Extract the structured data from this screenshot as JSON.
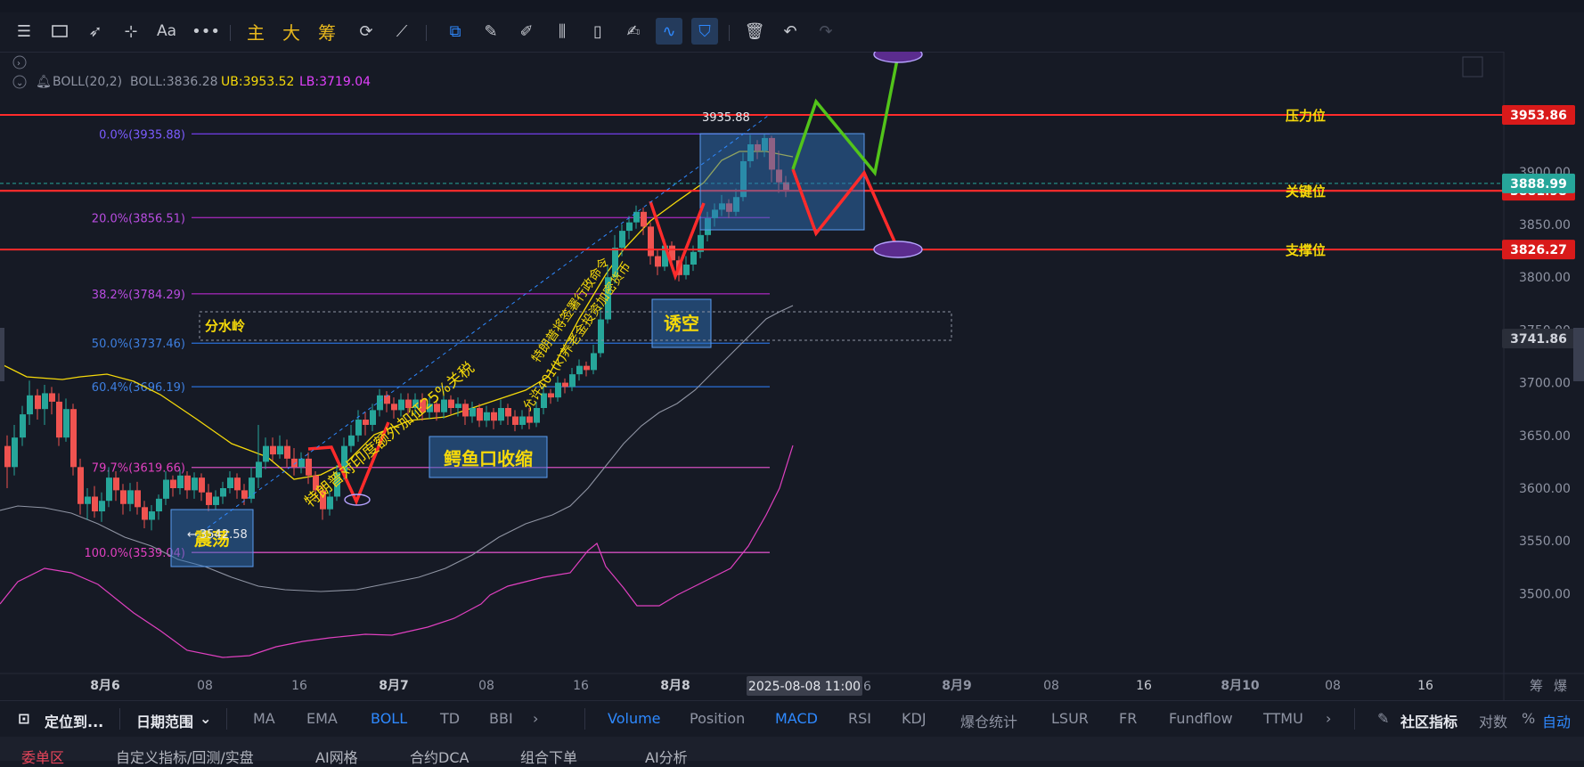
{
  "colors": {
    "bg": "#161a25",
    "up": "#26a69a",
    "down": "#ef5350",
    "accent": "#2e89ff",
    "key_line": "#ff2b2b",
    "yellow": "#f5d90a"
  },
  "toolbar": {
    "cjk_zhu": "主",
    "cjk_da": "大",
    "cjk_chou": "筹",
    "text_tool": "Aa",
    "icons": [
      "menu-icon",
      "rectangle-icon",
      "cursor-icon",
      "horizontal-line-icon",
      "text-icon",
      "more-icon",
      "magnet-icon",
      "pencil-icon",
      "brush-icon",
      "candle-icon",
      "trash-small-icon",
      "note-icon",
      "link-icon",
      "filter-icon",
      "trash-icon",
      "undo-icon",
      "redo-icon"
    ]
  },
  "indicator": {
    "name": "BOLL(20,2)",
    "boll": "BOLL:3836.28",
    "ub": "UB:3953.52",
    "lb": "LB:3719.04"
  },
  "price_axis": {
    "ticks": [
      "3900.00",
      "3850.00",
      "3800.00",
      "3750.00",
      "3700.00",
      "3650.00",
      "3600.00",
      "3550.00",
      "3500.00"
    ],
    "tag_pressure": "3953.86",
    "tag_current": "3888.99",
    "tag_current_under": "3881.98",
    "tag_support": "3826.27",
    "tag_divide": "3741.86"
  },
  "time_axis": {
    "labels": [
      "8月6",
      "08",
      "16",
      "8月7",
      "08",
      "16",
      "8月8",
      "8月9",
      "08",
      "16",
      "8月10",
      "08",
      "16"
    ],
    "crosshair": "2025-08-08 11:00",
    "crosshair_tail": "6",
    "chou": "筹",
    "bao": "爆"
  },
  "fib": {
    "l0": "0.0%(3935.88)",
    "l20": "20.0%(3856.51)",
    "l382": "38.2%(3784.29)",
    "l50": "50.0%(3737.46)",
    "l604": "60.4%(3696.19)",
    "l797": "79.7%(3619.66)",
    "l100": "100.0%(3539.04)"
  },
  "lines": {
    "pressure": "压力位",
    "key": "关键位",
    "support": "支撑位"
  },
  "annotations": {
    "high": "3935.88",
    "low": "3542.58",
    "zhendang": "震荡",
    "eyu": "鳄鱼口收缩",
    "youkong": "诱空",
    "fenshuiling": "分水岭",
    "trump1": "特朗普对印度额外加征25%关税",
    "trump2a": "特朗普将签署行政命令",
    "trump2b": "允许401(k)养老金投资加密货币"
  },
  "bottom": {
    "locate": "定位到...",
    "range": "日期范围",
    "inds": [
      "MA",
      "EMA",
      "BOLL",
      "TD",
      "BBI"
    ],
    "subs": [
      "Volume",
      "Position",
      "MACD",
      "RSI",
      "KDJ",
      "爆仓统计",
      "LSUR",
      "FR",
      "Fundflow",
      "TTMU"
    ],
    "community": "社区指标",
    "log": "对数",
    "pct": "%",
    "auto": "自动"
  },
  "tabs2": [
    "委单区",
    "自定义指标/回测/实盘",
    "AI网格",
    "合约DCA",
    "组合下单",
    "AI分析"
  ]
}
